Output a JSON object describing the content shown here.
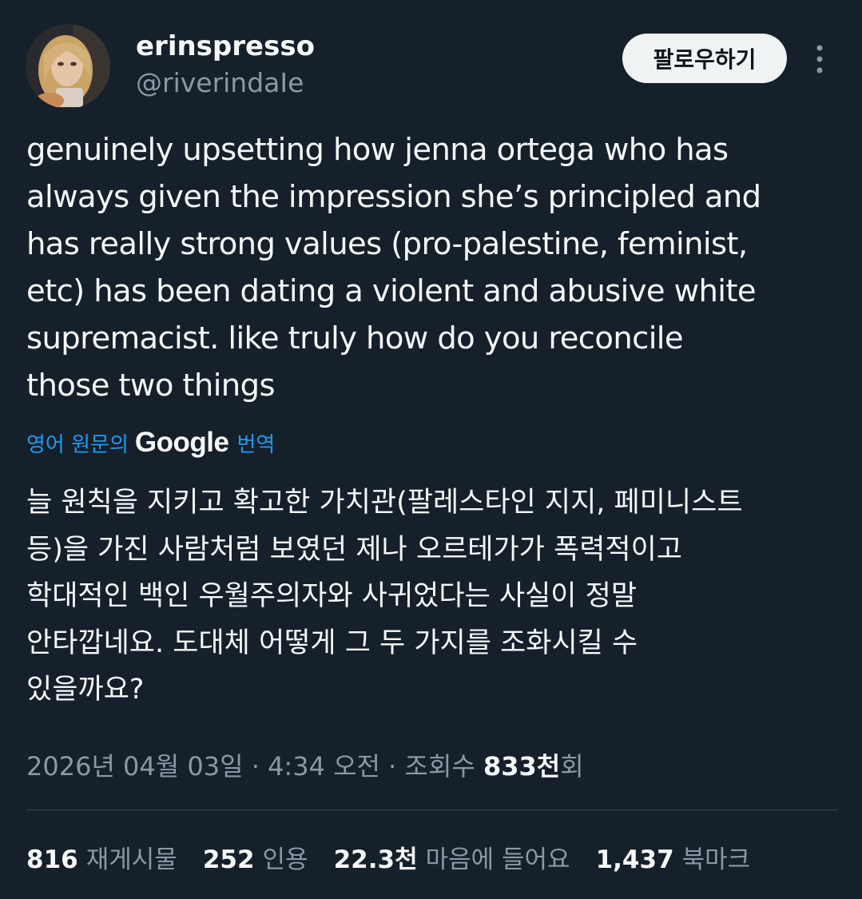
{
  "author": {
    "display_name": "erinspresso",
    "handle": "@riverindaIe",
    "avatar_icon": "profile-photo"
  },
  "follow_button": {
    "label": "팔로우하기"
  },
  "more_icon": "more-vertical-icon",
  "tweet": {
    "text": "genuinely upsetting how jenna ortega who has\nalways given the impression she’s principled and\nhas really strong values (pro-palestine, feminist,\netc) has been dating a violent and abusive white\nsupremacist. like truly how do you reconcile\nthose two things",
    "translation_prefix": "영어 원문의",
    "translation_provider": "Google",
    "translation_suffix": "번역",
    "translated_text": "늘 원칙을 지키고 확고한 가치관(팔레스타인 지지, 페미니스트\n등)을 가진 사람처럼 보였던 제나 오르테가가 폭력적이고\n학대적인 백인 우월주의자와 사귀었다는 사실이 정말\n안타깝네요. 도대체 어떻게 그 두 가지를 조화시킬 수\n있을까요?"
  },
  "meta": {
    "date": "2026년 04월 03일",
    "separator1": " · ",
    "time": "4:34 오전",
    "separator2": " · ",
    "views_label": "조회수 ",
    "views_count": "833천",
    "views_suffix": "회"
  },
  "stats": [
    {
      "count": "816",
      "label": "재게시물"
    },
    {
      "count": "252",
      "label": "인용"
    },
    {
      "count": "22.3천",
      "label": "마음에 들어요"
    },
    {
      "count": "1,437",
      "label": "북마크"
    }
  ],
  "colors": {
    "background": "#15202b",
    "text_primary": "#f7f9f9",
    "text_secondary": "#8b98a5",
    "link": "#1d9bf0",
    "divider": "#38444d",
    "button_bg": "#eff3f4"
  }
}
